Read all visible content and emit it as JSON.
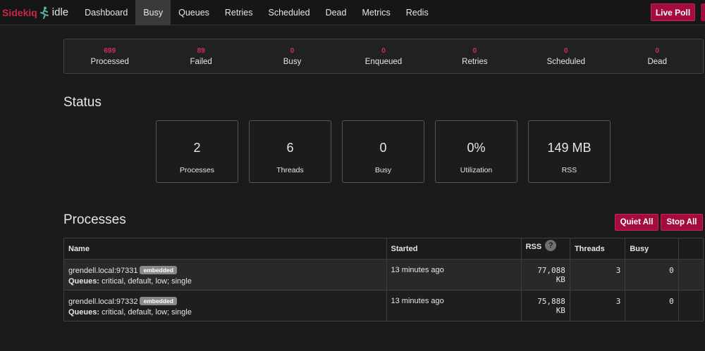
{
  "brand": {
    "name": "Sidekiq",
    "status": "idle",
    "icon": "runner-icon",
    "color": "#c7284b"
  },
  "nav": {
    "items": [
      {
        "label": "Dashboard",
        "active": false
      },
      {
        "label": "Busy",
        "active": true
      },
      {
        "label": "Queues",
        "active": false
      },
      {
        "label": "Retries",
        "active": false
      },
      {
        "label": "Scheduled",
        "active": false
      },
      {
        "label": "Dead",
        "active": false
      },
      {
        "label": "Metrics",
        "active": false
      },
      {
        "label": "Redis",
        "active": false
      }
    ],
    "live_poll_label": "Live Poll"
  },
  "stats": [
    {
      "value": "699",
      "label": "Processed"
    },
    {
      "value": "89",
      "label": "Failed"
    },
    {
      "value": "0",
      "label": "Busy"
    },
    {
      "value": "0",
      "label": "Enqueued"
    },
    {
      "value": "0",
      "label": "Retries"
    },
    {
      "value": "0",
      "label": "Scheduled"
    },
    {
      "value": "0",
      "label": "Dead"
    }
  ],
  "status": {
    "heading": "Status",
    "cards": [
      {
        "value": "2",
        "label": "Processes"
      },
      {
        "value": "6",
        "label": "Threads"
      },
      {
        "value": "0",
        "label": "Busy"
      },
      {
        "value": "0%",
        "label": "Utilization"
      },
      {
        "value": "149 MB",
        "label": "RSS"
      }
    ]
  },
  "processes": {
    "heading": "Processes",
    "quiet_all_label": "Quiet All",
    "stop_all_label": "Stop All",
    "columns": {
      "name": "Name",
      "started": "Started",
      "rss": "RSS",
      "rss_help": "?",
      "threads": "Threads",
      "busy": "Busy"
    },
    "rows": [
      {
        "name": "grendell.local:97331",
        "badge": "embedded",
        "queues_label": "Queues:",
        "queues": "critical, default, low; single",
        "started": "13 minutes ago",
        "rss": "77,088 KB",
        "threads": "3",
        "busy": "0"
      },
      {
        "name": "grendell.local:97332",
        "badge": "embedded",
        "queues_label": "Queues:",
        "queues": "critical, default, low; single",
        "started": "13 minutes ago",
        "rss": "75,888 KB",
        "threads": "3",
        "busy": "0"
      }
    ]
  },
  "colors": {
    "accent": "#a40c3d",
    "stat_value": "#d02e58",
    "background": "#1c1b1c"
  }
}
